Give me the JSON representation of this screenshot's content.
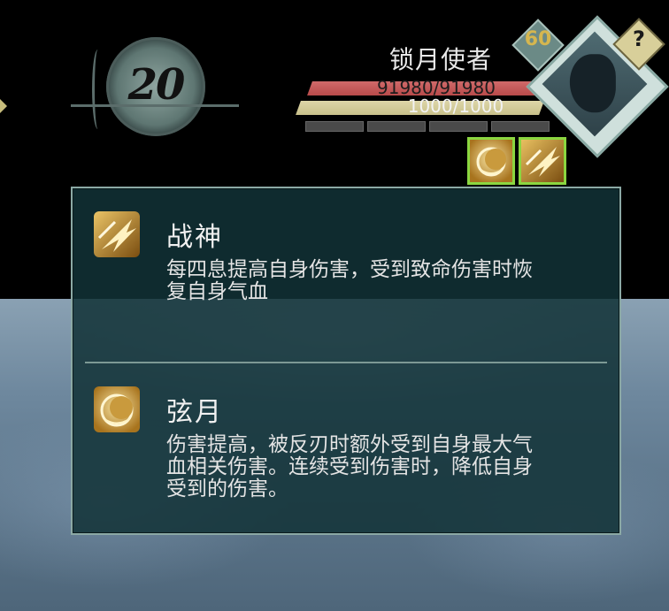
{
  "hud": {
    "round": "20",
    "boss": {
      "name": "锁月使者",
      "level": "60",
      "hp_text": "91980/91980",
      "hp_fraction": 1.0,
      "energy_text": "1000/1000",
      "energy_fraction": 1.0
    },
    "help_label": "?"
  },
  "buffs": [
    {
      "icon": "crescent-moon-icon"
    },
    {
      "icon": "war-god-slash-icon"
    }
  ],
  "tooltip": {
    "entries": [
      {
        "icon": "war-god-slash-icon",
        "name": "战神",
        "desc_lines": [
          "每四息提高自身伤害，受到致命伤害时恢",
          "复自身气血"
        ]
      },
      {
        "icon": "crescent-moon-icon",
        "name": "弦月",
        "desc_lines": [
          "伤害提高，被反刃时额外受到自身最大气",
          "血相关伤害。连续受到伤害时，降低自身",
          "受到的伤害。"
        ]
      }
    ]
  },
  "colors": {
    "hp": "#c85a5a",
    "energy": "#d4cc98",
    "buff_border": "#8bd640",
    "tooltip_bg": "#12323700",
    "level_text": "#d5b64f"
  }
}
